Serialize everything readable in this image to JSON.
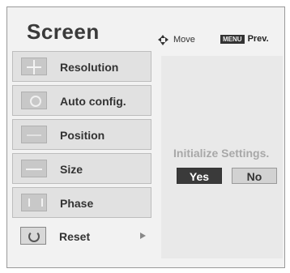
{
  "header": {
    "title": "Screen",
    "move_label": "Move",
    "menu_badge": "MENU",
    "prev_label": "Prev."
  },
  "menu": {
    "items": [
      {
        "label": "Resolution",
        "icon": "resolution-icon"
      },
      {
        "label": "Auto config.",
        "icon": "auto-config-icon"
      },
      {
        "label": "Position",
        "icon": "position-icon"
      },
      {
        "label": "Size",
        "icon": "size-icon"
      },
      {
        "label": "Phase",
        "icon": "phase-icon"
      },
      {
        "label": "Reset",
        "icon": "reset-icon",
        "selected": true
      }
    ]
  },
  "dialog": {
    "message": "Initialize Settings.",
    "yes_label": "Yes",
    "no_label": "No"
  },
  "colors": {
    "selected_button": "#3a3a3a",
    "menu_item_bg": "#e1e1e1",
    "dialog_text": "#a8a8a8"
  }
}
